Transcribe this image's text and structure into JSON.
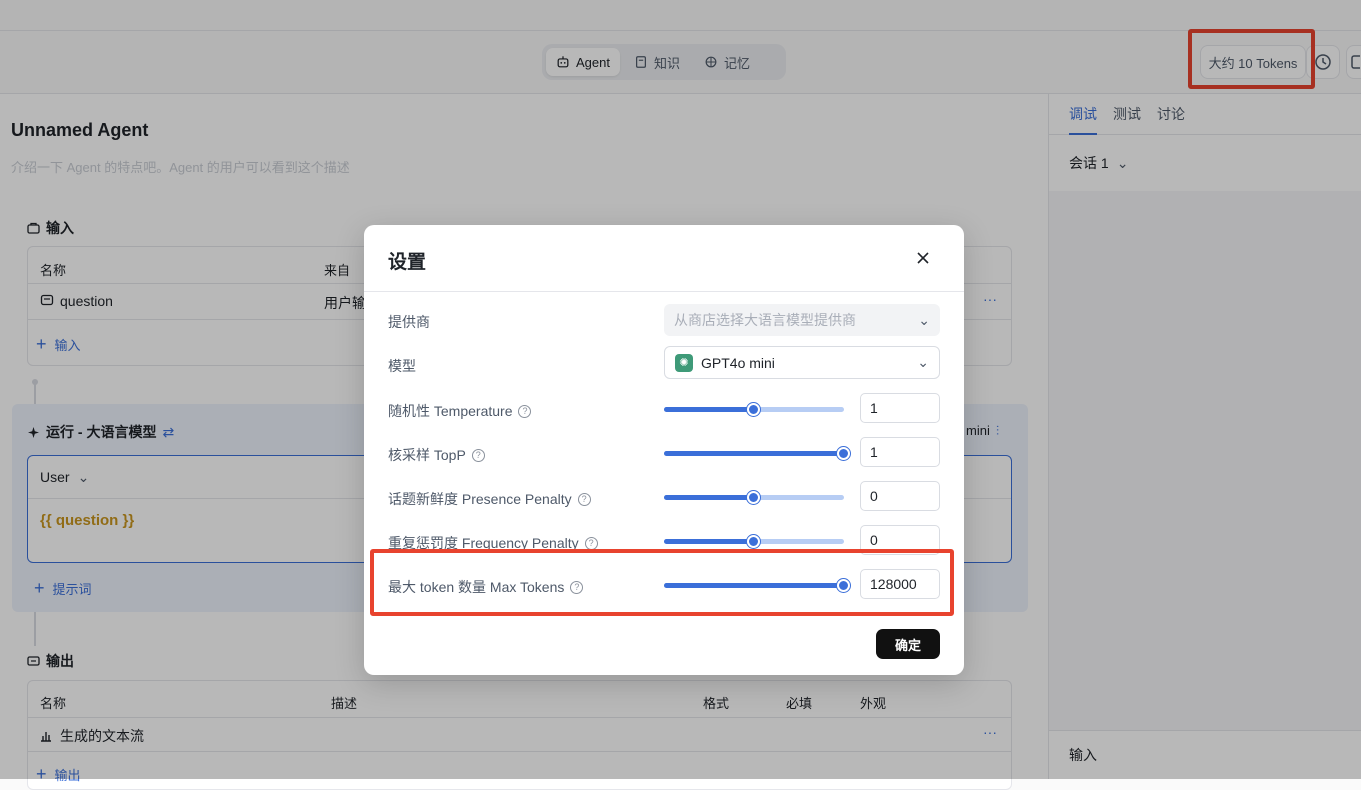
{
  "header": {
    "tabs": [
      {
        "label": "Agent",
        "icon": "robot-icon",
        "active": true
      },
      {
        "label": "知识",
        "icon": "book-icon",
        "active": false
      },
      {
        "label": "记忆",
        "icon": "brain-icon",
        "active": false
      }
    ],
    "tokens": "大约 10 Tokens"
  },
  "agent": {
    "name": "Unnamed Agent",
    "description_placeholder": "介绍一下 Agent 的特点吧。Agent 的用户可以看到这个描述"
  },
  "input_section": {
    "title": "输入",
    "columns": [
      "名称",
      "来自"
    ],
    "rows": [
      {
        "name": "question",
        "source": "用户输"
      }
    ],
    "add_label": "输入"
  },
  "run_section": {
    "title": "运行 - 大语言模型",
    "model_tag": "mini",
    "role": "User",
    "prompt": "{{ question }}",
    "add_label": "提示词"
  },
  "output_section": {
    "title": "输出",
    "columns": [
      "名称",
      "描述",
      "格式",
      "必填",
      "外观"
    ],
    "rows": [
      {
        "name": "生成的文本流"
      }
    ],
    "add_label": "输出"
  },
  "right_panel": {
    "tabs": [
      {
        "label": "调试",
        "active": true
      },
      {
        "label": "测试",
        "active": false
      },
      {
        "label": "讨论",
        "active": false
      }
    ],
    "session": "会话 1",
    "input_label": "输入"
  },
  "modal": {
    "title": "设置",
    "provider": {
      "label": "提供商",
      "placeholder": "从商店选择大语言模型提供商"
    },
    "model": {
      "label": "模型",
      "value": "GPT4o mini"
    },
    "params": [
      {
        "label": "随机性 Temperature",
        "value": "1",
        "fraction": 0.5
      },
      {
        "label": "核采样 TopP",
        "value": "1",
        "fraction": 1.0
      },
      {
        "label": "话题新鲜度 Presence Penalty",
        "value": "0",
        "fraction": 0.5
      },
      {
        "label": "重复惩罚度 Frequency Penalty",
        "value": "0",
        "fraction": 0.5
      },
      {
        "label": "最大 token 数量 Max Tokens",
        "value": "128000",
        "fraction": 1.0
      }
    ],
    "confirm_label": "确定"
  },
  "colors": {
    "accent": "#3b6fd9",
    "highlight": "#e8432e",
    "prompt_text": "#c9961f"
  }
}
